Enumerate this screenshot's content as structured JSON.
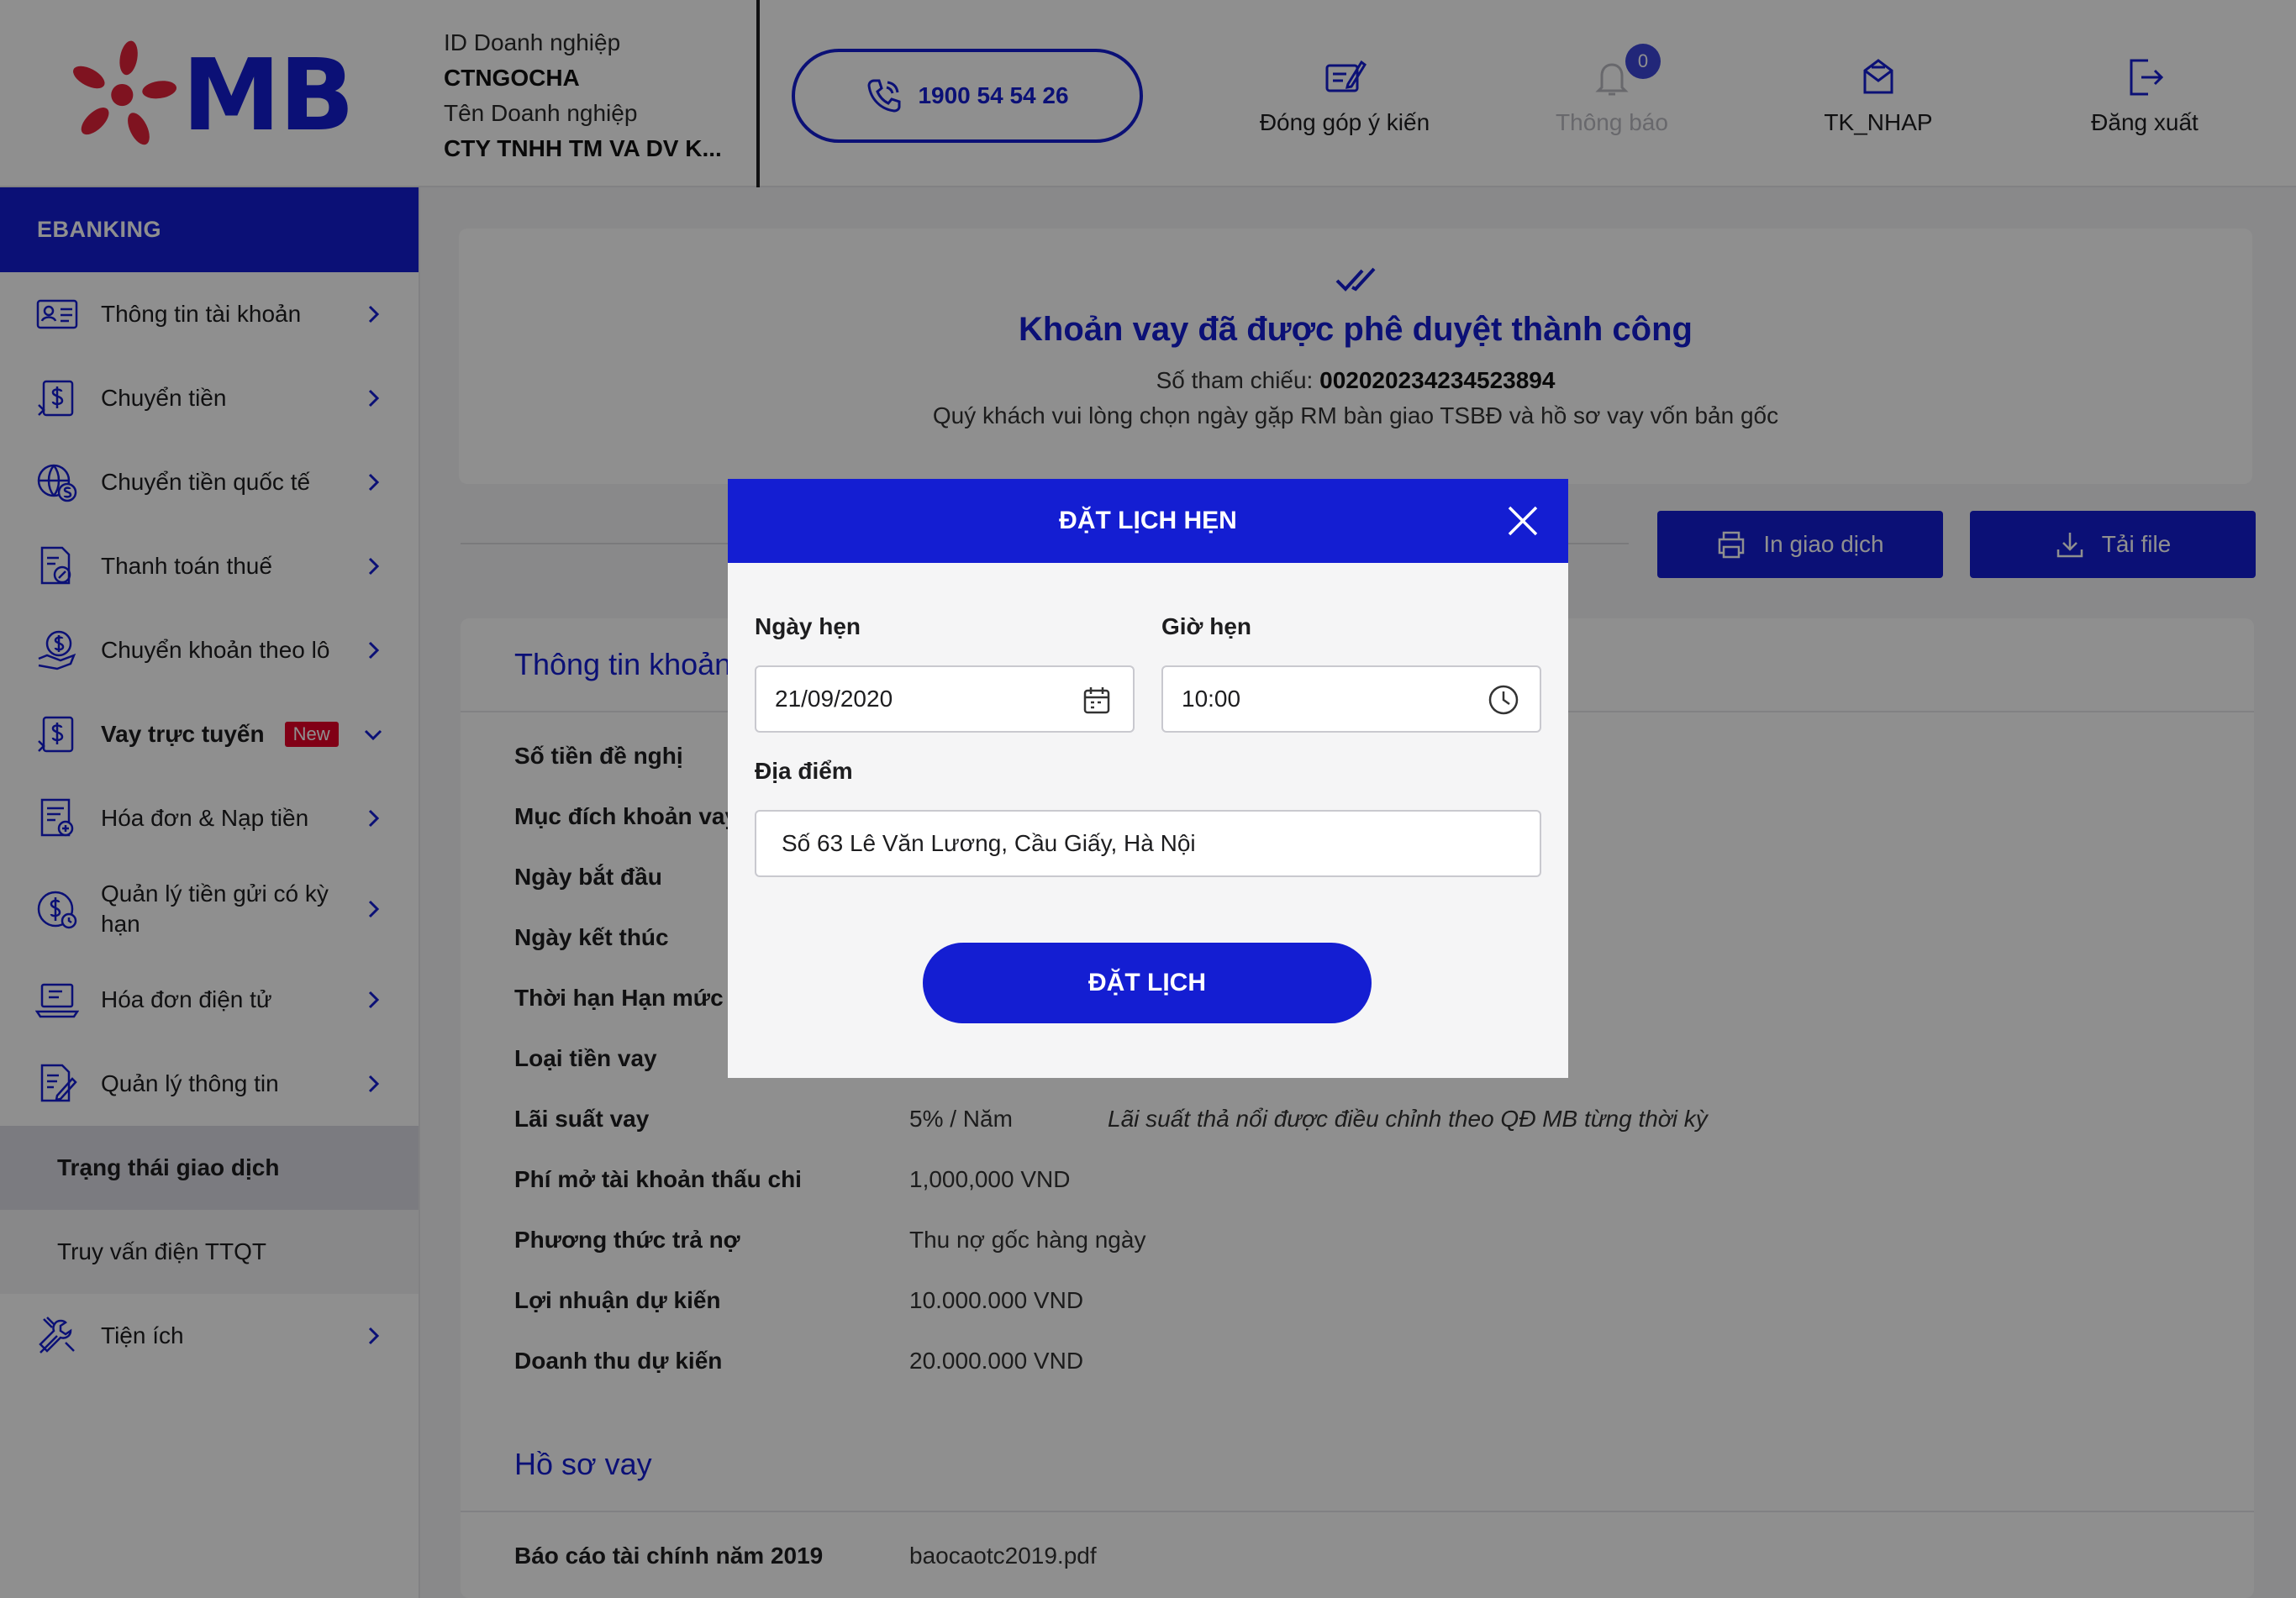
{
  "brand": {
    "logo_text": "MB"
  },
  "company": {
    "id_label": "ID Doanh nghiệp",
    "id_value": "CTNGOCHA",
    "name_label": "Tên Doanh nghiệp",
    "name_value": "CTY TNHH TM VA DV K..."
  },
  "header": {
    "hotline": "1900 54 54 26",
    "feedback_label": "Đóng góp ý kiến",
    "notifications_label": "Thông báo",
    "notifications_count": "0",
    "user_label": "TK_NHAP",
    "logout_label": "Đăng xuất"
  },
  "sidebar": {
    "title": "EBANKING",
    "items": [
      {
        "label": "Thông tin tài khoản"
      },
      {
        "label": "Chuyển tiền"
      },
      {
        "label": "Chuyển tiền quốc tế"
      },
      {
        "label": "Thanh toán thuế"
      },
      {
        "label": "Chuyển khoản theo lô"
      },
      {
        "label": "Vay trực tuyến",
        "badge": "New"
      },
      {
        "label": "Hóa đơn & Nạp tiền"
      },
      {
        "label": "Quản lý tiền gửi có kỳ hạn"
      },
      {
        "label": "Hóa đơn điện tử"
      },
      {
        "label": "Quản lý thông tin"
      }
    ],
    "sub_items": [
      {
        "label": "Trạng thái giao dịch"
      },
      {
        "label": "Truy vấn điện TTQT"
      }
    ],
    "utilities": {
      "label": "Tiện ích"
    }
  },
  "success": {
    "title": "Khoản vay đã được phê duyệt thành công",
    "ref_label": "Số tham chiếu:",
    "ref_value": "002020234234523894",
    "note": "Quý khách vui lòng chọn ngày gặp RM bàn giao TSBĐ và hồ sơ vay vốn bản gốc"
  },
  "actions": {
    "print_label": "In giao dịch",
    "download_label": "Tải file"
  },
  "loan_info": {
    "title": "Thông tin khoản vay",
    "rows": [
      {
        "label": "Số tiền đề nghị",
        "value": ""
      },
      {
        "label": "Mục đích  khoản vay",
        "value": ""
      },
      {
        "label": "Ngày bắt đầu",
        "value": ""
      },
      {
        "label": "Ngày kết thúc",
        "value": ""
      },
      {
        "label": "Thời hạn Hạn mức",
        "value": ""
      },
      {
        "label": "Loại tiền vay",
        "value": ""
      },
      {
        "label": "Lãi suất vay",
        "value": "5% / Năm",
        "note": "Lãi suất thả nổi được điều chỉnh theo QĐ MB từng thời kỳ"
      },
      {
        "label": "Phí mở tài khoản thấu chi",
        "value": "1,000,000 VND"
      },
      {
        "label": "Phương thức trả nợ",
        "value": "Thu nợ gốc hàng ngày"
      },
      {
        "label": "Lợi nhuận dự kiến",
        "value": "10.000.000 VND"
      },
      {
        "label": "Doanh thu dự kiến",
        "value": "20.000.000 VND"
      }
    ]
  },
  "loan_docs": {
    "title": "Hồ sơ vay",
    "rows": [
      {
        "label": "Báo cáo tài chính năm 2019",
        "value": "baocaotc2019.pdf"
      }
    ]
  },
  "modal": {
    "title": "ĐẶT LỊCH HẸN",
    "date_label": "Ngày hẹn",
    "date_value": "21/09/2020",
    "time_label": "Giờ hẹn",
    "time_value": "10:00",
    "location_label": "Địa điểm",
    "location_value": "Số 63 Lê Văn Lương, Cầu Giấy, Hà Nội",
    "submit_label": "ĐẶT LỊCH"
  },
  "colors": {
    "brand_blue": "#141ed2",
    "accent_red": "#e60028",
    "logo_red": "#e3223a"
  }
}
